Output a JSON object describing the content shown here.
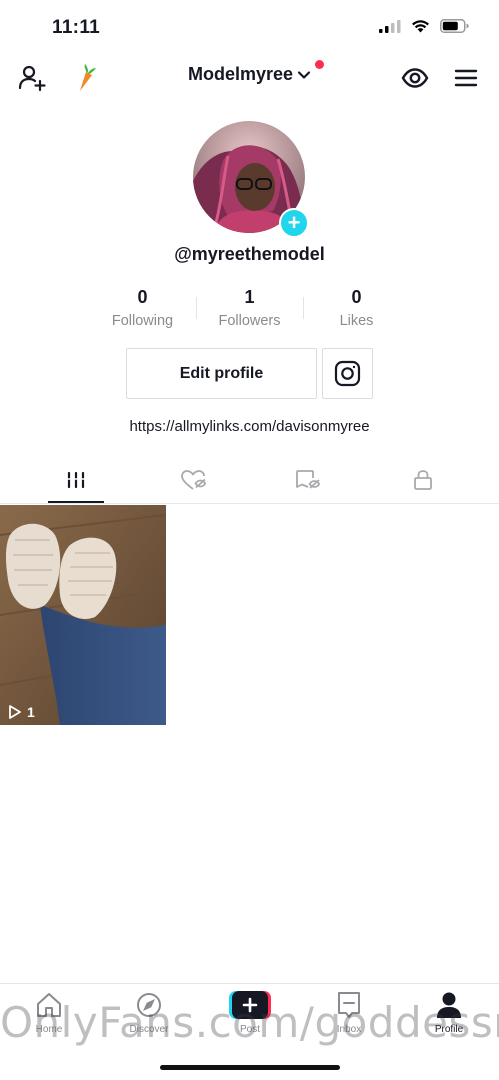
{
  "status_bar": {
    "time": "11:11"
  },
  "header": {
    "username": "Modelmyree"
  },
  "profile": {
    "handle": "@myreethemodel",
    "stats": [
      {
        "value": "0",
        "label": "Following"
      },
      {
        "value": "1",
        "label": "Followers"
      },
      {
        "value": "0",
        "label": "Likes"
      }
    ],
    "edit_label": "Edit profile",
    "bio_link": "https://allmylinks.com/davisonmyree"
  },
  "videos": [
    {
      "play_count": "1"
    }
  ],
  "bottom_nav": [
    {
      "label": "Home",
      "icon": "home-icon"
    },
    {
      "label": "Discover",
      "icon": "compass-icon"
    },
    {
      "label": "Post",
      "icon": "plus-icon"
    },
    {
      "label": "Inbox",
      "icon": "inbox-icon"
    },
    {
      "label": "Profile",
      "icon": "person-icon"
    }
  ],
  "watermark": "OnlyFans.com/goddessmyree",
  "colors": {
    "accent_red": "#fe2c55",
    "accent_cyan": "#20d5ec",
    "text": "#161823",
    "muted": "#8a8b91"
  }
}
